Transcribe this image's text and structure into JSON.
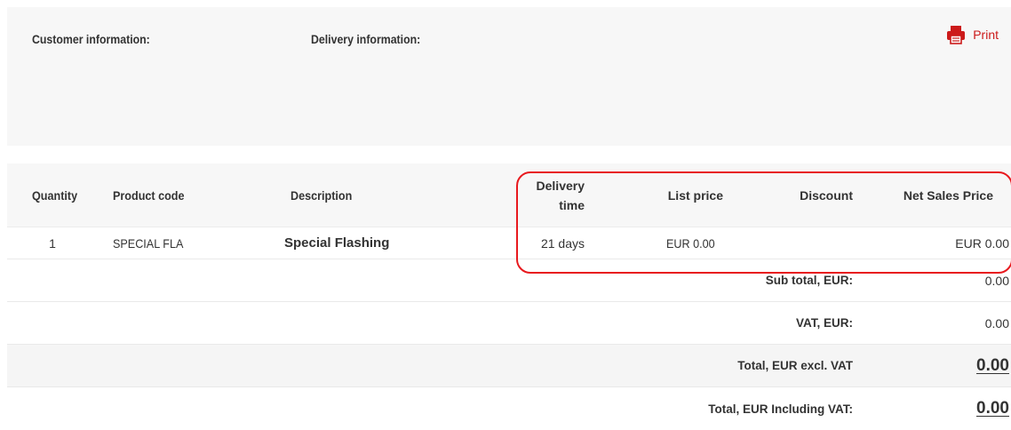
{
  "info": {
    "customer_label": "Customer information:",
    "delivery_label": "Delivery information:",
    "print_label": "Print",
    "print_icon": "printer-icon"
  },
  "table": {
    "headers": {
      "quantity": "Quantity",
      "product_code": "Product code",
      "description": "Description",
      "delivery_time_line1": "Delivery",
      "delivery_time_line2": "time",
      "list_price": "List price",
      "discount": "Discount",
      "net_sales_price": "Net Sales Price"
    },
    "items": [
      {
        "quantity": "1",
        "product_code": "SPECIAL FLA",
        "description": "Special Flashing",
        "delivery_time": "21 days",
        "list_price": "EUR 0.00",
        "discount": "",
        "net_sales_price": "EUR 0.00"
      }
    ]
  },
  "summary": {
    "subtotal_label": "Sub total, EUR:",
    "subtotal_value": "0.00",
    "vat_label": "VAT, EUR:",
    "vat_value": "0.00",
    "total_excl_label": "Total, EUR excl. VAT",
    "total_excl_value": "0.00",
    "total_incl_label": "Total, EUR Including VAT:",
    "total_incl_value": "0.00"
  },
  "colors": {
    "accent": "#cc1a1a",
    "highlight": "#e8191e",
    "panel": "#f7f7f7"
  }
}
